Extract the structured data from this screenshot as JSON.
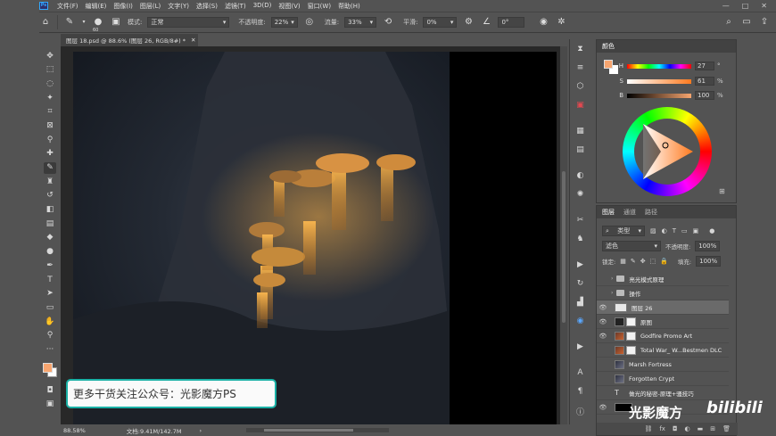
{
  "menu": {
    "app_icon": "Ps",
    "items": [
      "文件(F)",
      "编辑(E)",
      "图像(I)",
      "图层(L)",
      "文字(Y)",
      "选择(S)",
      "滤镜(T)",
      "3D(D)",
      "视图(V)",
      "窗口(W)",
      "帮助(H)"
    ]
  },
  "options": {
    "brush_size": "60",
    "mode_label": "模式:",
    "mode_value": "正常",
    "opacity_label": "不透明度:",
    "opacity_value": "22%",
    "flow_label": "流量:",
    "flow_value": "33%",
    "smoothing_label": "平滑:",
    "smoothing_value": "0%",
    "angle_value": "0°"
  },
  "document": {
    "tab_title": "图层 18.psd @ 88.6% (图层 26, RGB/8#) *",
    "zoom": "88.58%",
    "doc_size": "文档:9.41M/142.7M"
  },
  "banner_text": "更多干货关注公众号：光影魔方PS",
  "color_panel": {
    "tabs": [
      "颜色"
    ],
    "fg_color": "#f7a56f",
    "sliders": [
      {
        "label": "H",
        "value": "27",
        "unit": "°"
      },
      {
        "label": "S",
        "value": "61",
        "unit": "%"
      },
      {
        "label": "B",
        "value": "100",
        "unit": "%"
      }
    ]
  },
  "layers_panel": {
    "tabs": [
      "图层",
      "通道",
      "路径"
    ],
    "filter_label": "类型",
    "blend_mode": "滤色",
    "opacity_label": "不透明度:",
    "opacity_value": "100%",
    "lock_label": "锁定:",
    "fill_label": "填充:",
    "fill_value": "100%",
    "layers": [
      {
        "name": "亮光模式原理",
        "type": "folder",
        "visible": false
      },
      {
        "name": "操作",
        "type": "folder",
        "visible": false
      },
      {
        "name": "图层 26",
        "type": "layer",
        "visible": true,
        "selected": true
      },
      {
        "name": "原图",
        "type": "layer",
        "visible": true
      },
      {
        "name": "Godfire Promo Art",
        "type": "photo",
        "visible": true
      },
      {
        "name": "Total War_ W...Bestmen DLC",
        "type": "photo",
        "visible": false
      },
      {
        "name": "Marsh Fortress",
        "type": "photo2",
        "visible": false
      },
      {
        "name": "Forgotten Crypt",
        "type": "photo2",
        "visible": false
      },
      {
        "name": "做光的秘密-原理+骚技巧",
        "type": "text",
        "visible": false
      },
      {
        "name": "",
        "type": "black",
        "visible": true
      }
    ]
  },
  "watermark": {
    "brand": "光影魔方",
    "site": "bilibili"
  }
}
